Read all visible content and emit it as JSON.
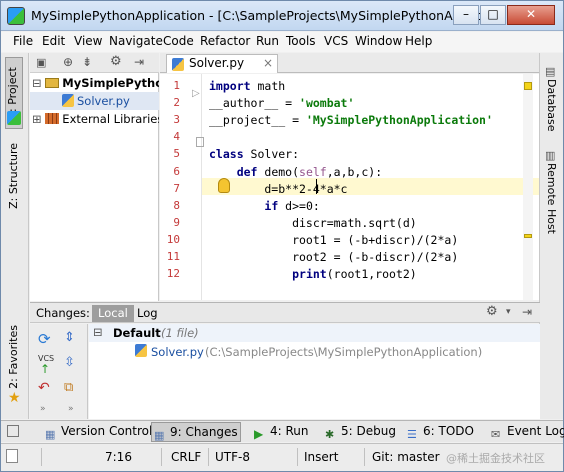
{
  "window": {
    "title": "MySimplePythonApplication - [C:\\SampleProjects\\MySimplePythonApplicatio...",
    "controls": {
      "minimize": "–",
      "maximize": "□",
      "close": "✕"
    }
  },
  "menu": [
    "File",
    "Edit",
    "View",
    "Navigate",
    "Code",
    "Refactor",
    "Run",
    "Tools",
    "VCS",
    "Window",
    "Help"
  ],
  "left_strip": {
    "project": "1: Project",
    "structure": "Z: Structure",
    "favorites": "2: Favorites"
  },
  "right_strip": {
    "database": "Database",
    "remote_host": "Remote Host"
  },
  "project_tree": {
    "root": "MySimplePytho",
    "file": "Solver.py",
    "libraries": "External Libraries"
  },
  "editor": {
    "tab": "Solver.py",
    "line_numbers": [
      "1",
      "2",
      "3",
      "4",
      "5",
      "6",
      "7",
      "8",
      "9",
      "10",
      "11",
      "12"
    ],
    "lines": [
      {
        "kw": "import",
        "rest": " math"
      },
      {
        "pre": "__author__ = ",
        "str": "'wombat'"
      },
      {
        "pre": "__project__ = ",
        "str": "'MySimplePythonApplication'"
      },
      {
        "pre": ""
      },
      {
        "kw": "class",
        "rest": " Solver:"
      },
      {
        "pre": "    ",
        "kw": "def",
        "rest": " demo(",
        "self": "self",
        "tail": ",a,b,c):"
      },
      {
        "pre": "        d=b**2-4*a*c"
      },
      {
        "pre": "        ",
        "kw": "if",
        "rest": " d>=0:"
      },
      {
        "pre": "            discr=math.sqrt(d)"
      },
      {
        "pre": "            root1 = (-b+discr)/(2*a)"
      },
      {
        "pre": "            root2 = (-b-discr)/(2*a)"
      },
      {
        "pre": "            ",
        "kw": "print",
        "rest": "(root1,root2)"
      }
    ]
  },
  "changes": {
    "title": "Changes:",
    "tabs": {
      "local": "Local",
      "log": "Log"
    },
    "group": "Default",
    "group_count": "(1 file)",
    "file": "Solver.py",
    "path": "(C:\\SampleProjects\\MySimplePythonApplication)",
    "tool_labels": {
      "vcs": "VCS"
    }
  },
  "bottom_tabs": {
    "version_control": "Version Control",
    "changes": "9: Changes",
    "run": "4: Run",
    "debug": "5: Debug",
    "todo": "6: TODO",
    "event_log": "Event Log"
  },
  "status": {
    "position": "7:16",
    "line_sep": "CRLF",
    "encoding": "UTF-8",
    "mode": "Insert",
    "git": "Git: master",
    "watermark": "@稀土掘金技术社区"
  }
}
